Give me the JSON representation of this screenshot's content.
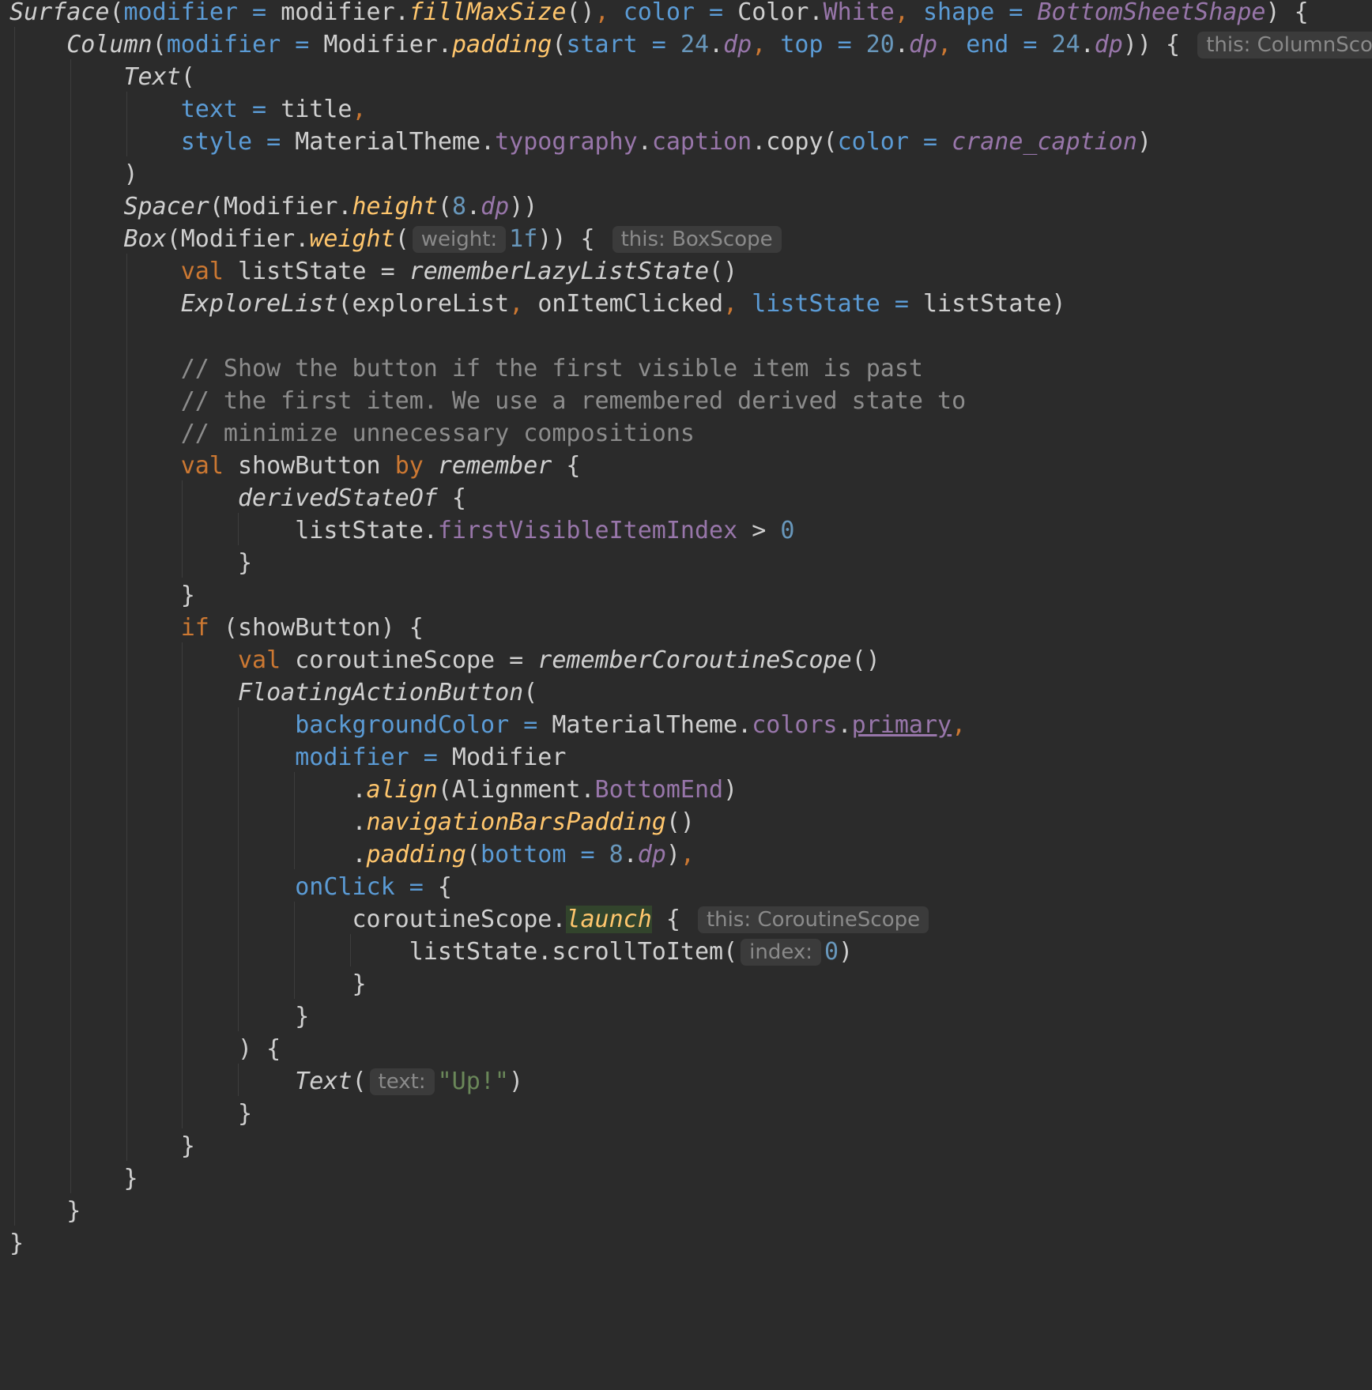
{
  "editor": {
    "colors": {
      "background": "#2b2b2b",
      "keyword": "#cc7832",
      "parameter": "#5b9bd5",
      "number": "#6897bb",
      "function": "#ffc66d",
      "property": "#9876aa",
      "comment": "#8c8c8c",
      "string": "#6a8759",
      "inlay_bg": "#3b3b3b"
    },
    "lines": [
      [
        {
          "t": "Surface",
          "c": "comp"
        },
        {
          "t": "("
        },
        {
          "t": "modifier",
          "c": "param"
        },
        {
          "t": " = ",
          "c": "param"
        },
        {
          "t": "modifier."
        },
        {
          "t": "fillMaxSize",
          "c": "fn"
        },
        {
          "t": "()"
        },
        {
          "t": ", ",
          "c": "punc"
        },
        {
          "t": "color",
          "c": "param"
        },
        {
          "t": " = ",
          "c": "param"
        },
        {
          "t": "Color."
        },
        {
          "t": "White",
          "c": "prop"
        },
        {
          "t": ", ",
          "c": "punc"
        },
        {
          "t": "shape",
          "c": "param"
        },
        {
          "t": " = ",
          "c": "param"
        },
        {
          "t": "BottomSheetShape",
          "c": "propi"
        },
        {
          "t": ") {"
        }
      ],
      [
        {
          "t": "    "
        },
        {
          "t": "Column",
          "c": "comp"
        },
        {
          "t": "("
        },
        {
          "t": "modifier",
          "c": "param"
        },
        {
          "t": " = ",
          "c": "param"
        },
        {
          "t": "Modifier."
        },
        {
          "t": "padding",
          "c": "fn"
        },
        {
          "t": "("
        },
        {
          "t": "start",
          "c": "param"
        },
        {
          "t": " = ",
          "c": "param"
        },
        {
          "t": "24",
          "c": "num"
        },
        {
          "t": "."
        },
        {
          "t": "dp",
          "c": "propi"
        },
        {
          "t": ", ",
          "c": "punc"
        },
        {
          "t": "top",
          "c": "param"
        },
        {
          "t": " = ",
          "c": "param"
        },
        {
          "t": "20",
          "c": "num"
        },
        {
          "t": "."
        },
        {
          "t": "dp",
          "c": "propi"
        },
        {
          "t": ", ",
          "c": "punc"
        },
        {
          "t": "end",
          "c": "param"
        },
        {
          "t": " = ",
          "c": "param"
        },
        {
          "t": "24",
          "c": "num"
        },
        {
          "t": "."
        },
        {
          "t": "dp",
          "c": "propi"
        },
        {
          "t": ")) { "
        },
        {
          "t": "this: ColumnScope",
          "c": "inlay"
        }
      ],
      [
        {
          "t": "        "
        },
        {
          "t": "Text",
          "c": "comp"
        },
        {
          "t": "("
        }
      ],
      [
        {
          "t": "            "
        },
        {
          "t": "text",
          "c": "param"
        },
        {
          "t": " = ",
          "c": "param"
        },
        {
          "t": "title"
        },
        {
          "t": ",",
          "c": "punc"
        }
      ],
      [
        {
          "t": "            "
        },
        {
          "t": "style",
          "c": "param"
        },
        {
          "t": " = ",
          "c": "param"
        },
        {
          "t": "MaterialTheme."
        },
        {
          "t": "typography",
          "c": "prop"
        },
        {
          "t": "."
        },
        {
          "t": "caption",
          "c": "prop"
        },
        {
          "t": ".copy("
        },
        {
          "t": "color",
          "c": "param"
        },
        {
          "t": " = ",
          "c": "param"
        },
        {
          "t": "crane_caption",
          "c": "propi"
        },
        {
          "t": ")"
        }
      ],
      [
        {
          "t": "        )"
        }
      ],
      [
        {
          "t": "        "
        },
        {
          "t": "Spacer",
          "c": "comp"
        },
        {
          "t": "(Modifier."
        },
        {
          "t": "height",
          "c": "fn"
        },
        {
          "t": "("
        },
        {
          "t": "8",
          "c": "num"
        },
        {
          "t": "."
        },
        {
          "t": "dp",
          "c": "propi"
        },
        {
          "t": "))"
        }
      ],
      [
        {
          "t": "        "
        },
        {
          "t": "Box",
          "c": "comp"
        },
        {
          "t": "(Modifier."
        },
        {
          "t": "weight",
          "c": "fn"
        },
        {
          "t": "("
        },
        {
          "t": "weight:",
          "c": "inlay"
        },
        {
          "t": "1f",
          "c": "num"
        },
        {
          "t": ")) { "
        },
        {
          "t": "this: BoxScope",
          "c": "inlay"
        }
      ],
      [
        {
          "t": "            "
        },
        {
          "t": "val",
          "c": "kw"
        },
        {
          "t": " listState = "
        },
        {
          "t": "rememberLazyListState",
          "c": "comp"
        },
        {
          "t": "()"
        }
      ],
      [
        {
          "t": "            "
        },
        {
          "t": "ExploreList",
          "c": "comp"
        },
        {
          "t": "(exploreList"
        },
        {
          "t": ", ",
          "c": "punc"
        },
        {
          "t": "onItemClicked"
        },
        {
          "t": ", ",
          "c": "punc"
        },
        {
          "t": "listState",
          "c": "param"
        },
        {
          "t": " = ",
          "c": "param"
        },
        {
          "t": "listState)"
        }
      ],
      [],
      [
        {
          "t": "            "
        },
        {
          "t": "// Show the button if the first visible item is past",
          "c": "cmt"
        }
      ],
      [
        {
          "t": "            "
        },
        {
          "t": "// the first item. We use a remembered derived state to",
          "c": "cmt"
        }
      ],
      [
        {
          "t": "            "
        },
        {
          "t": "// minimize unnecessary compositions",
          "c": "cmt"
        }
      ],
      [
        {
          "t": "            "
        },
        {
          "t": "val",
          "c": "kw"
        },
        {
          "t": " showButton "
        },
        {
          "t": "by",
          "c": "kw"
        },
        {
          "t": " "
        },
        {
          "t": "remember",
          "c": "comp"
        },
        {
          "t": " {"
        }
      ],
      [
        {
          "t": "                "
        },
        {
          "t": "derivedStateOf",
          "c": "comp"
        },
        {
          "t": " {"
        }
      ],
      [
        {
          "t": "                    listState."
        },
        {
          "t": "firstVisibleItemIndex",
          "c": "prop"
        },
        {
          "t": " > "
        },
        {
          "t": "0",
          "c": "num"
        }
      ],
      [
        {
          "t": "                }"
        }
      ],
      [
        {
          "t": "            }"
        }
      ],
      [
        {
          "t": "            "
        },
        {
          "t": "if",
          "c": "kw"
        },
        {
          "t": " (showButton) {"
        }
      ],
      [
        {
          "t": "                "
        },
        {
          "t": "val",
          "c": "kw"
        },
        {
          "t": " coroutineScope = "
        },
        {
          "t": "rememberCoroutineScope",
          "c": "comp"
        },
        {
          "t": "()"
        }
      ],
      [
        {
          "t": "                "
        },
        {
          "t": "FloatingActionButton",
          "c": "comp"
        },
        {
          "t": "("
        }
      ],
      [
        {
          "t": "                    "
        },
        {
          "t": "backgroundColor",
          "c": "param"
        },
        {
          "t": " = ",
          "c": "param"
        },
        {
          "t": "MaterialTheme."
        },
        {
          "t": "colors",
          "c": "prop"
        },
        {
          "t": "."
        },
        {
          "t": "primary",
          "c": "prop u"
        },
        {
          "t": ",",
          "c": "punc"
        }
      ],
      [
        {
          "t": "                    "
        },
        {
          "t": "modifier",
          "c": "param"
        },
        {
          "t": " = ",
          "c": "param"
        },
        {
          "t": "Modifier"
        }
      ],
      [
        {
          "t": "                        ."
        },
        {
          "t": "align",
          "c": "fn"
        },
        {
          "t": "(Alignment."
        },
        {
          "t": "BottomEnd",
          "c": "prop"
        },
        {
          "t": ")"
        }
      ],
      [
        {
          "t": "                        ."
        },
        {
          "t": "navigationBarsPadding",
          "c": "fn"
        },
        {
          "t": "()"
        }
      ],
      [
        {
          "t": "                        ."
        },
        {
          "t": "padding",
          "c": "fn"
        },
        {
          "t": "("
        },
        {
          "t": "bottom",
          "c": "param"
        },
        {
          "t": " = ",
          "c": "param"
        },
        {
          "t": "8",
          "c": "num"
        },
        {
          "t": "."
        },
        {
          "t": "dp",
          "c": "propi"
        },
        {
          "t": ")"
        },
        {
          "t": ",",
          "c": "punc"
        }
      ],
      [
        {
          "t": "                    "
        },
        {
          "t": "onClick",
          "c": "param"
        },
        {
          "t": " = ",
          "c": "param"
        },
        {
          "t": "{"
        }
      ],
      [
        {
          "t": "                        coroutineScope."
        },
        {
          "t": "launch",
          "c": "fn hl"
        },
        {
          "t": " { "
        },
        {
          "t": "this: CoroutineScope",
          "c": "inlay"
        }
      ],
      [
        {
          "t": "                            listState.scrollToItem("
        },
        {
          "t": "index:",
          "c": "inlay"
        },
        {
          "t": "0",
          "c": "num"
        },
        {
          "t": ")"
        }
      ],
      [
        {
          "t": "                        }"
        }
      ],
      [
        {
          "t": "                    }"
        }
      ],
      [
        {
          "t": "                ) {"
        }
      ],
      [
        {
          "t": "                    "
        },
        {
          "t": "Text",
          "c": "comp"
        },
        {
          "t": "("
        },
        {
          "t": "text:",
          "c": "inlay"
        },
        {
          "t": "\"Up!\"",
          "c": "str"
        },
        {
          "t": ")"
        }
      ],
      [
        {
          "t": "                }"
        }
      ],
      [
        {
          "t": "            }"
        }
      ],
      [
        {
          "t": "        }"
        }
      ],
      [
        {
          "t": "    }"
        }
      ],
      [
        {
          "t": "}"
        }
      ]
    ]
  }
}
